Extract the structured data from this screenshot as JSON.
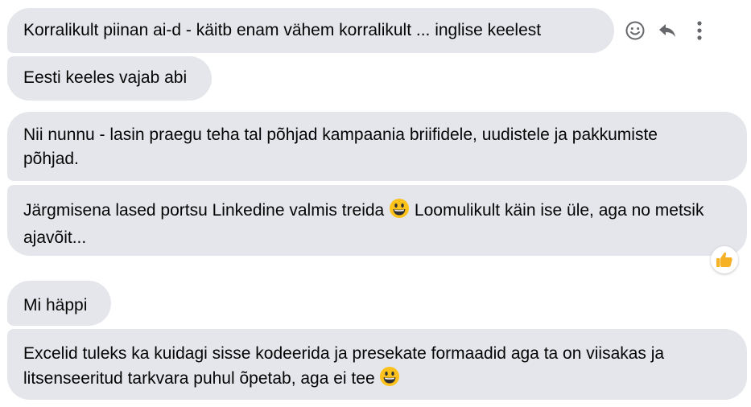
{
  "messages": [
    {
      "text": "Korralikult piinan ai-d - käitb enam vähem korralikult ... inglise keelest"
    },
    {
      "text": "Eesti keeles vajab abi"
    },
    {
      "text": "Nii nunnu - lasin praegu teha tal põhjad kampaania briifidele, uudistele ja pakkumiste põhjad."
    },
    {
      "text_before": "Järgmisena lased portsu Linkedine valmis treida",
      "text_after": "Loomulikult käin ise üle, aga no metsik ajavõit...",
      "emoji": "grinning-face",
      "reaction": "thumbs-up"
    },
    {
      "text": "Mi häppi"
    },
    {
      "text": "Excelid tuleks ka kuidagi sisse kodeerida ja presekate formaadid aga ta on viisakas ja litsenseeritud tarkvara puhul õpetab, aga ei tee",
      "emoji": "grinning-face"
    }
  ],
  "actions": [
    "smiley-icon",
    "reply-icon",
    "more-options-icon"
  ],
  "colors": {
    "bubble": "#e4e6eb",
    "icon": "#65676b",
    "text": "#050505"
  }
}
